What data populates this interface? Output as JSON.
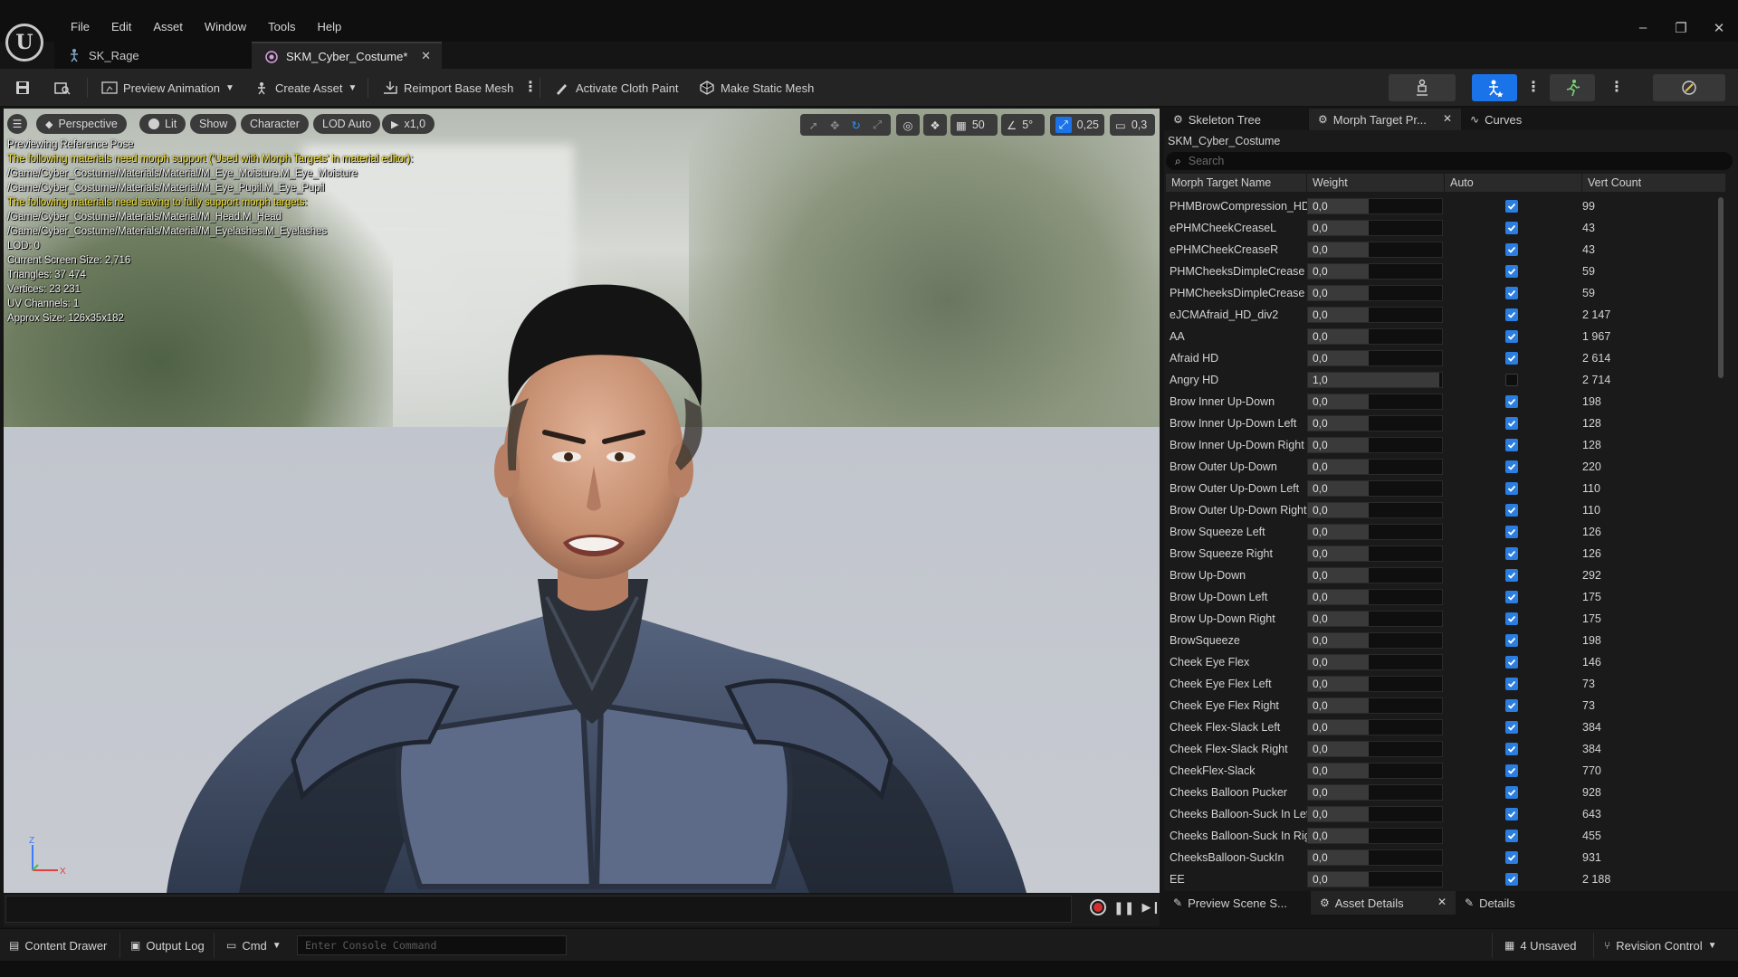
{
  "menu": [
    "File",
    "Edit",
    "Asset",
    "Window",
    "Tools",
    "Help"
  ],
  "tabs": [
    {
      "label": "SK_Rage",
      "active": false
    },
    {
      "label": "SKM_Cyber_Costume*",
      "active": true
    }
  ],
  "toolbar": {
    "preview_animation": "Preview Animation",
    "create_asset": "Create Asset",
    "reimport_base_mesh": "Reimport Base Mesh",
    "activate_cloth_paint": "Activate Cloth Paint",
    "make_static_mesh": "Make Static Mesh"
  },
  "viewport": {
    "perspective": "Perspective",
    "lit": "Lit",
    "show": "Show",
    "character": "Character",
    "lod": "LOD Auto",
    "play_rate": "x1,0",
    "grid_size": "50",
    "rotation_snap": "5°",
    "scale_snap": "0,25",
    "camera_speed": "0,3",
    "stats": {
      "line1": "Previewing Reference Pose",
      "warn1": "The following materials need morph support ('Used with Morph Targets' in material editor):",
      "mat1": "/Game/Cyber_Costume/Materials/Material/M_Eye_Moisture.M_Eye_Moisture",
      "mat2": "/Game/Cyber_Costume/Materials/Material/M_Eye_Pupil.M_Eye_Pupil",
      "warn2": "The following materials need saving to fully support morph targets:",
      "mat3": "/Game/Cyber_Costume/Materials/Material/M_Head.M_Head",
      "mat4": "/Game/Cyber_Costume/Materials/Material/M_Eyelashes.M_Eyelashes",
      "lod": "LOD: 0",
      "screen_size": "Current Screen Size: 2,716",
      "triangles": "Triangles: 37 474",
      "vertices": "Vertices: 23 231",
      "uv": "UV Channels: 1",
      "approx": "Approx Size: 126x35x182"
    },
    "axis_z": "Z",
    "axis_x": "X"
  },
  "panel": {
    "tabs": {
      "skeleton": "Skeleton Tree",
      "morph": "Morph Target Pr...",
      "curves": "Curves"
    },
    "asset_name": "SKM_Cyber_Costume",
    "search_placeholder": "Search",
    "columns": {
      "name": "Morph Target Name",
      "weight": "Weight",
      "auto": "Auto",
      "vert": "Vert Count"
    },
    "rows": [
      {
        "name": "PHMBrowCompression_HD",
        "weight": "0,0",
        "fill": 0.45,
        "auto": true,
        "vert": "99"
      },
      {
        "name": "ePHMCheekCreaseL",
        "weight": "0,0",
        "fill": 0.45,
        "auto": true,
        "vert": "43"
      },
      {
        "name": "ePHMCheekCreaseR",
        "weight": "0,0",
        "fill": 0.45,
        "auto": true,
        "vert": "43"
      },
      {
        "name": "PHMCheeksDimpleCrease",
        "weight": "0,0",
        "fill": 0.45,
        "auto": true,
        "vert": "59"
      },
      {
        "name": "PHMCheeksDimpleCrease",
        "weight": "0,0",
        "fill": 0.45,
        "auto": true,
        "vert": "59"
      },
      {
        "name": "eJCMAfraid_HD_div2",
        "weight": "0,0",
        "fill": 0.45,
        "auto": true,
        "vert": "2 147"
      },
      {
        "name": "AA",
        "weight": "0,0",
        "fill": 0.45,
        "auto": true,
        "vert": "1 967"
      },
      {
        "name": "Afraid HD",
        "weight": "0,0",
        "fill": 0.45,
        "auto": true,
        "vert": "2 614"
      },
      {
        "name": "Angry HD",
        "weight": "1,0",
        "fill": 0.98,
        "auto": false,
        "vert": "2 714"
      },
      {
        "name": "Brow Inner Up-Down",
        "weight": "0,0",
        "fill": 0.45,
        "auto": true,
        "vert": "198"
      },
      {
        "name": "Brow Inner Up-Down Left",
        "weight": "0,0",
        "fill": 0.45,
        "auto": true,
        "vert": "128"
      },
      {
        "name": "Brow Inner Up-Down Right",
        "weight": "0,0",
        "fill": 0.45,
        "auto": true,
        "vert": "128"
      },
      {
        "name": "Brow Outer Up-Down",
        "weight": "0,0",
        "fill": 0.45,
        "auto": true,
        "vert": "220"
      },
      {
        "name": "Brow Outer Up-Down Left",
        "weight": "0,0",
        "fill": 0.45,
        "auto": true,
        "vert": "110"
      },
      {
        "name": "Brow Outer Up-Down Right",
        "weight": "0,0",
        "fill": 0.45,
        "auto": true,
        "vert": "110"
      },
      {
        "name": "Brow Squeeze Left",
        "weight": "0,0",
        "fill": 0.45,
        "auto": true,
        "vert": "126"
      },
      {
        "name": "Brow Squeeze Right",
        "weight": "0,0",
        "fill": 0.45,
        "auto": true,
        "vert": "126"
      },
      {
        "name": "Brow Up-Down",
        "weight": "0,0",
        "fill": 0.45,
        "auto": true,
        "vert": "292"
      },
      {
        "name": "Brow Up-Down Left",
        "weight": "0,0",
        "fill": 0.45,
        "auto": true,
        "vert": "175"
      },
      {
        "name": "Brow Up-Down Right",
        "weight": "0,0",
        "fill": 0.45,
        "auto": true,
        "vert": "175"
      },
      {
        "name": "BrowSqueeze",
        "weight": "0,0",
        "fill": 0.45,
        "auto": true,
        "vert": "198"
      },
      {
        "name": "Cheek Eye Flex",
        "weight": "0,0",
        "fill": 0.45,
        "auto": true,
        "vert": "146"
      },
      {
        "name": "Cheek Eye Flex Left",
        "weight": "0,0",
        "fill": 0.45,
        "auto": true,
        "vert": "73"
      },
      {
        "name": "Cheek Eye Flex Right",
        "weight": "0,0",
        "fill": 0.45,
        "auto": true,
        "vert": "73"
      },
      {
        "name": "Cheek Flex-Slack Left",
        "weight": "0,0",
        "fill": 0.45,
        "auto": true,
        "vert": "384"
      },
      {
        "name": "Cheek Flex-Slack Right",
        "weight": "0,0",
        "fill": 0.45,
        "auto": true,
        "vert": "384"
      },
      {
        "name": "CheekFlex-Slack",
        "weight": "0,0",
        "fill": 0.45,
        "auto": true,
        "vert": "770"
      },
      {
        "name": "Cheeks Balloon Pucker",
        "weight": "0,0",
        "fill": 0.45,
        "auto": true,
        "vert": "928"
      },
      {
        "name": "Cheeks Balloon-Suck In Left",
        "weight": "0,0",
        "fill": 0.45,
        "auto": true,
        "vert": "643"
      },
      {
        "name": "Cheeks Balloon-Suck In Right",
        "weight": "0,0",
        "fill": 0.45,
        "auto": true,
        "vert": "455"
      },
      {
        "name": "CheeksBalloon-SuckIn",
        "weight": "0,0",
        "fill": 0.45,
        "auto": true,
        "vert": "931"
      },
      {
        "name": "EE",
        "weight": "0,0",
        "fill": 0.45,
        "auto": true,
        "vert": "2 188"
      }
    ],
    "bottom_tabs": {
      "scene": "Preview Scene S...",
      "asset": "Asset Details",
      "details": "Details"
    }
  },
  "statusbar": {
    "content_drawer": "Content Drawer",
    "output_log": "Output Log",
    "cmd": "Cmd",
    "cmd_placeholder": "Enter Console Command",
    "unsaved": "4 Unsaved",
    "revision_control": "Revision Control"
  },
  "colors": {
    "accent": "#1a73e8",
    "checkbox": "#2a7de1",
    "warning_text": "#f5e43a"
  }
}
